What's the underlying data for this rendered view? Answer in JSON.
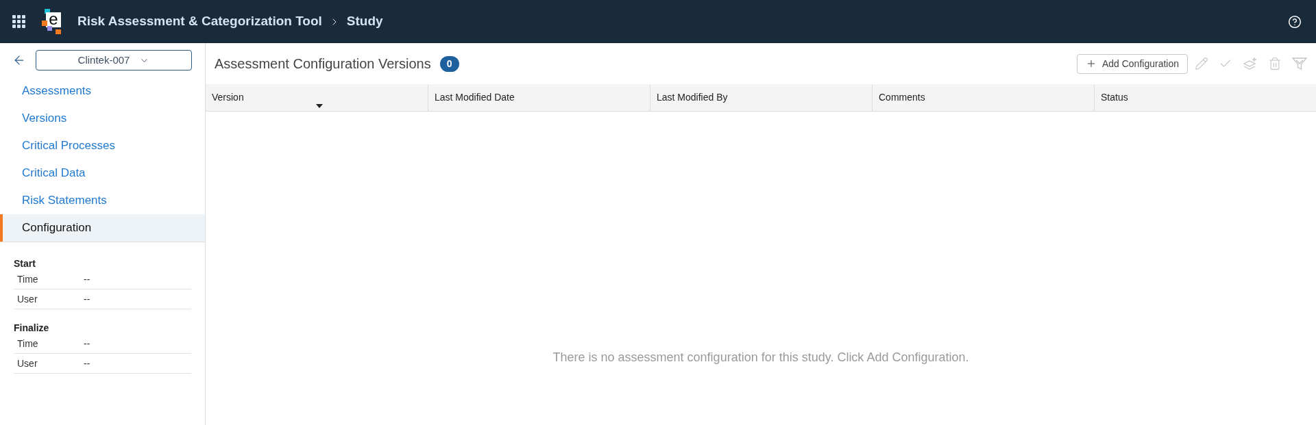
{
  "header": {
    "logo_letter": "e",
    "app_title": "Risk Assessment & Categorization Tool",
    "breadcrumb": "Study"
  },
  "sidebar": {
    "study_selector": {
      "value": "Clintek-007"
    },
    "nav_items": [
      {
        "label": "Assessments",
        "selected": false
      },
      {
        "label": "Versions",
        "selected": false
      },
      {
        "label": "Critical Processes",
        "selected": false
      },
      {
        "label": "Critical Data",
        "selected": false
      },
      {
        "label": "Risk Statements",
        "selected": false
      },
      {
        "label": "Configuration",
        "selected": true
      }
    ],
    "sections": [
      {
        "title": "Start",
        "rows": [
          {
            "label": "Time",
            "value": "--"
          },
          {
            "label": "User",
            "value": "--"
          }
        ]
      },
      {
        "title": "Finalize",
        "rows": [
          {
            "label": "Time",
            "value": "--"
          },
          {
            "label": "User",
            "value": "--"
          }
        ]
      }
    ]
  },
  "main": {
    "title": "Assessment Configuration Versions",
    "count": "0",
    "toolbar": {
      "add_button": "Add Configuration",
      "actions": [
        {
          "kind": "edit",
          "disabled": true
        },
        {
          "kind": "approve",
          "disabled": true
        },
        {
          "kind": "add_layer",
          "disabled": true
        },
        {
          "kind": "delete",
          "disabled": true
        },
        {
          "kind": "filter",
          "disabled": true
        }
      ]
    },
    "table": {
      "columns": [
        {
          "label": "Version",
          "sorted": true
        },
        {
          "label": "Last Modified Date",
          "sorted": false
        },
        {
          "label": "Last Modified By",
          "sorted": false
        },
        {
          "label": "Comments",
          "sorted": false
        },
        {
          "label": "Status",
          "sorted": false
        }
      ],
      "empty_message": "There is no assessment configuration for this study. Click Add Configuration."
    }
  }
}
